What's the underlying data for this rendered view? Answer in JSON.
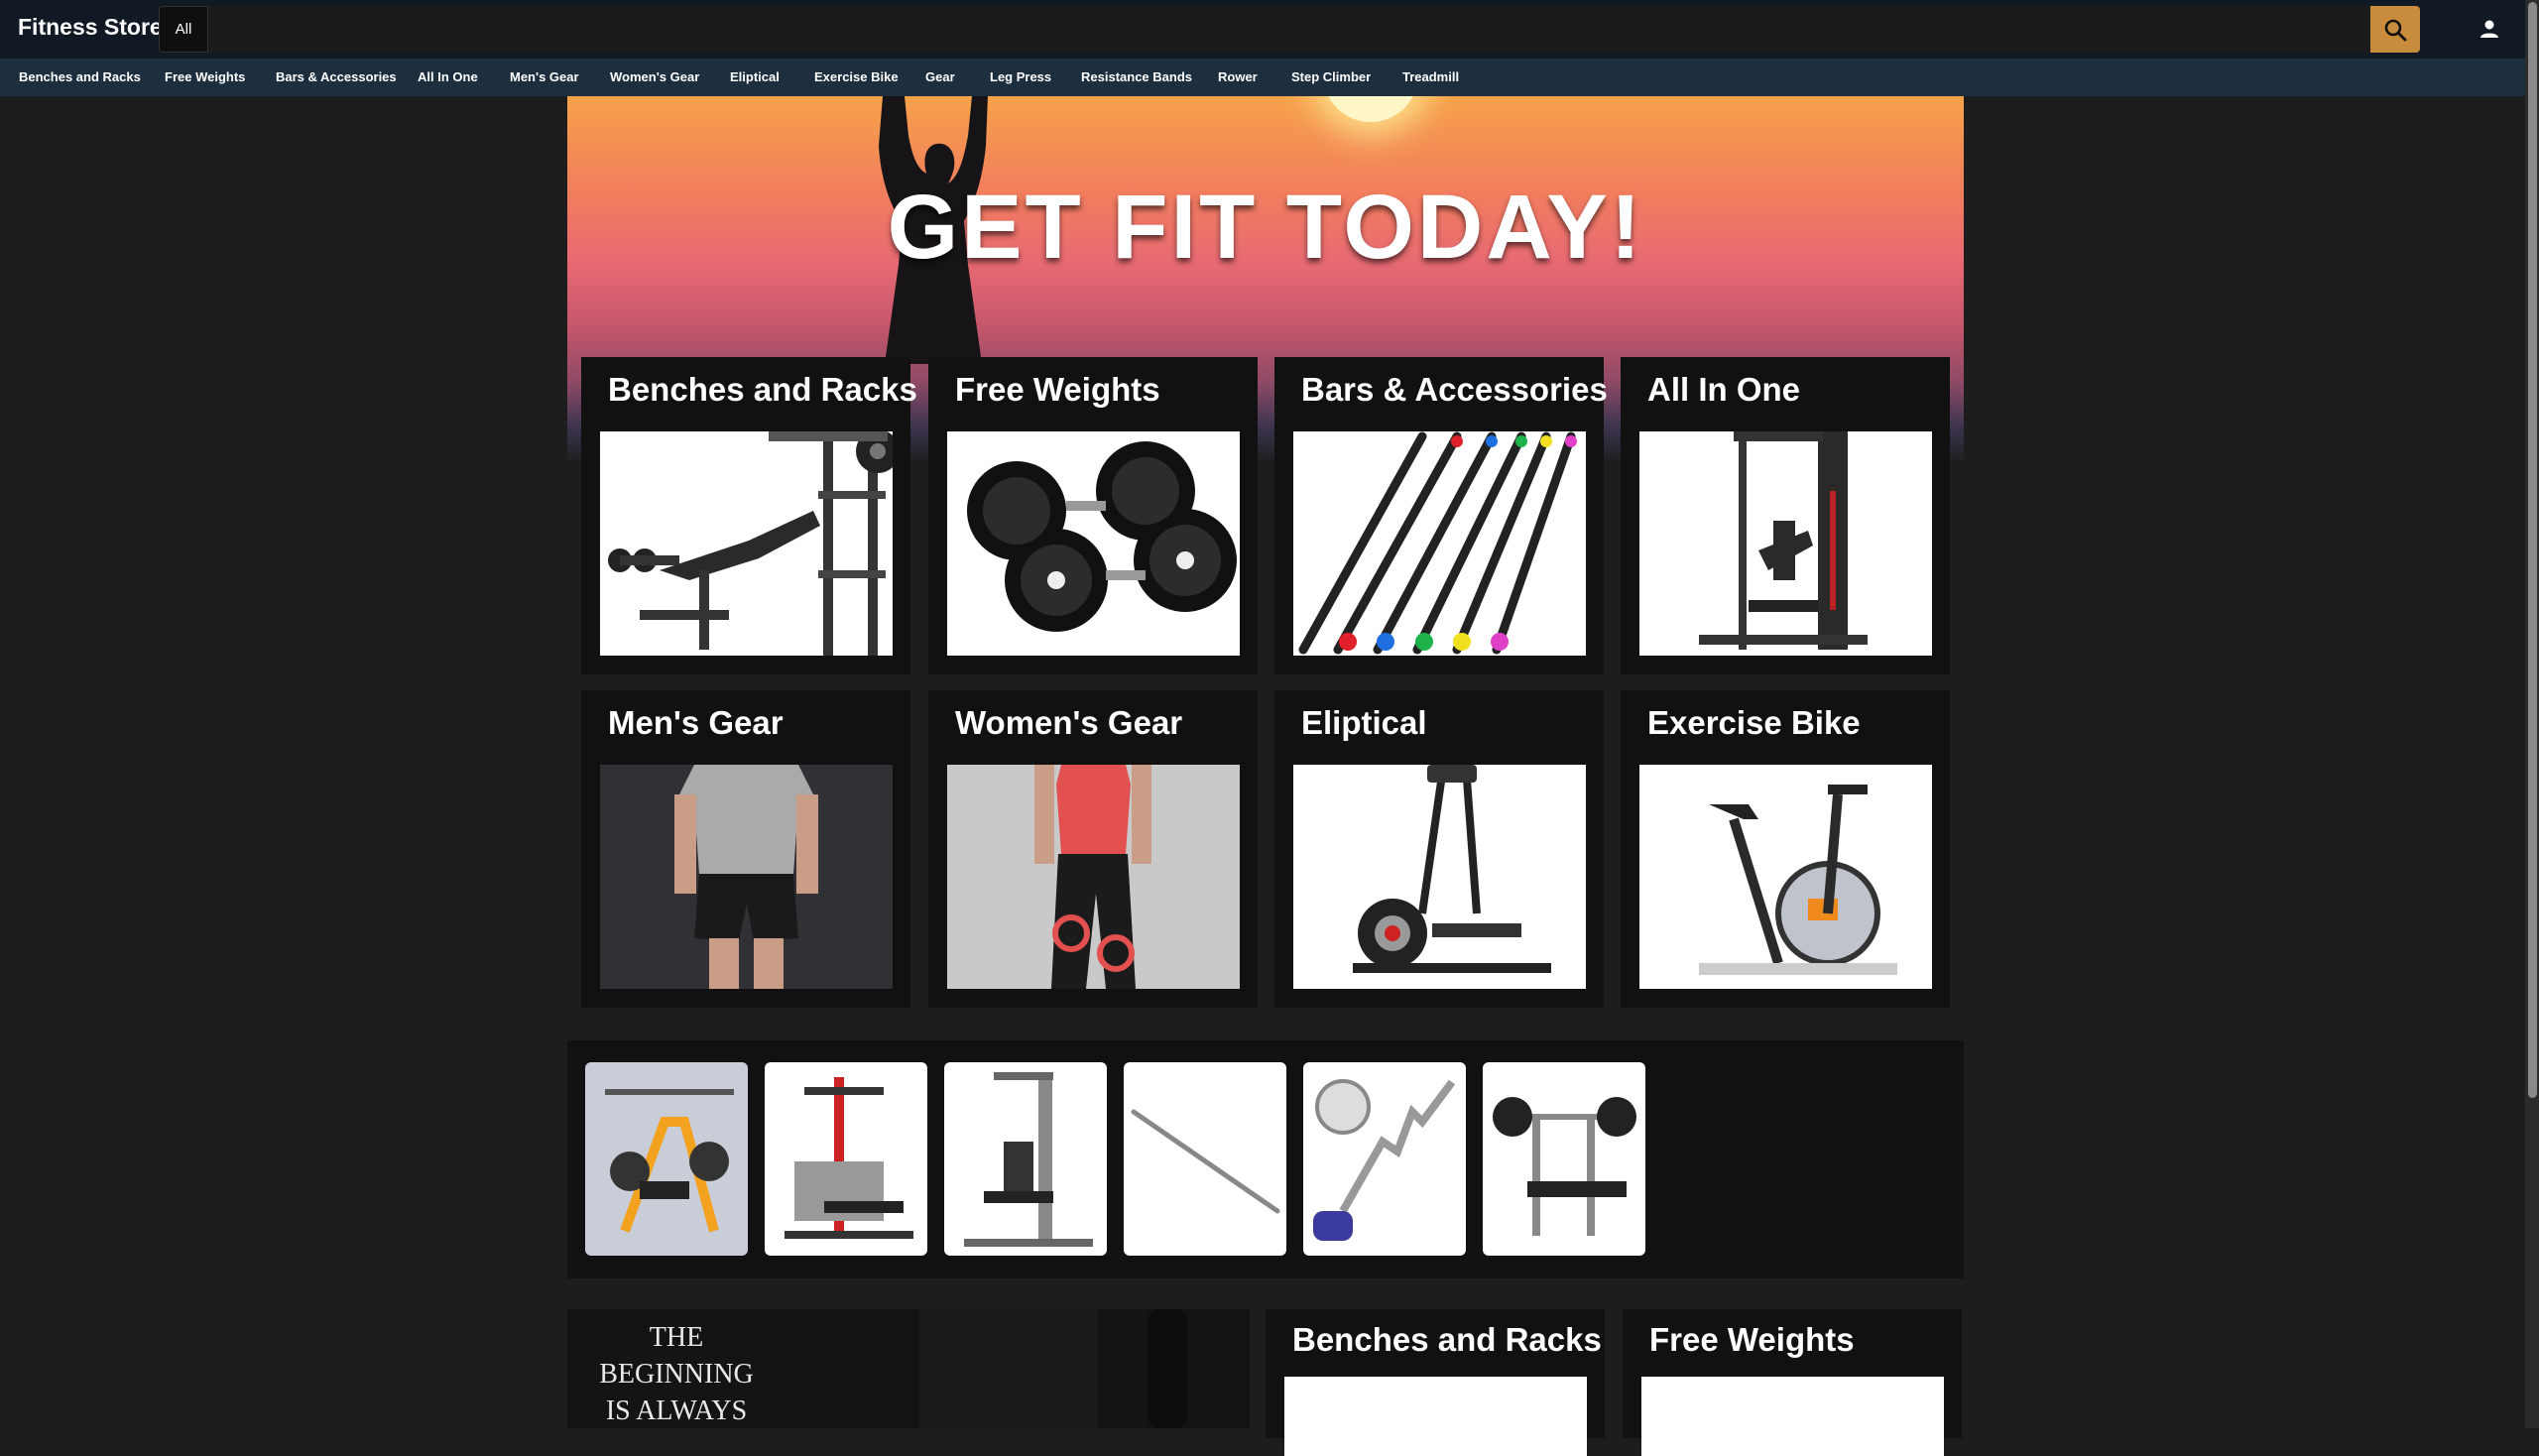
{
  "header": {
    "brand": "Fitness Store",
    "category_select": "All",
    "search_placeholder": ""
  },
  "nav": [
    "Benches and Racks",
    "Free Weights",
    "Bars & Accessories",
    "All In One",
    "Men's Gear",
    "Women's Gear",
    "Eliptical",
    "Exercise Bike",
    "Gear",
    "Leg Press",
    "Resistance Bands",
    "Rower",
    "Step Climber",
    "Treadmill"
  ],
  "hero": {
    "title": "GET FIT TODAY!"
  },
  "category_cards": [
    {
      "title": "Benches and Racks",
      "image": "weight-bench-image"
    },
    {
      "title": "Free Weights",
      "image": "dumbbells-image"
    },
    {
      "title": "Bars & Accessories",
      "image": "weighted-bars-image"
    },
    {
      "title": "All In One",
      "image": "home-gym-image"
    },
    {
      "title": "Men's Gear",
      "image": "mens-apparel-image"
    },
    {
      "title": "Women's Gear",
      "image": "womens-apparel-image"
    },
    {
      "title": "Eliptical",
      "image": "elliptical-machine-image"
    },
    {
      "title": "Exercise Bike",
      "image": "spin-bike-image"
    }
  ],
  "product_strip": [
    "power-rack-orange",
    "home-gym-red",
    "home-gym-grey",
    "straight-barbell",
    "ez-curl-bar",
    "olympic-bench"
  ],
  "bottom": {
    "quote": "THE BEGINNING IS ALWAYS TOUGH",
    "cards": [
      {
        "title": "Benches and Racks"
      },
      {
        "title": "Free Weights"
      }
    ]
  },
  "colors": {
    "topbar": "#111a24",
    "navbar": "#1d2f3e",
    "search_button": "#c98b3c",
    "page_bg": "#1d1d1d",
    "card_bg": "#111111"
  }
}
